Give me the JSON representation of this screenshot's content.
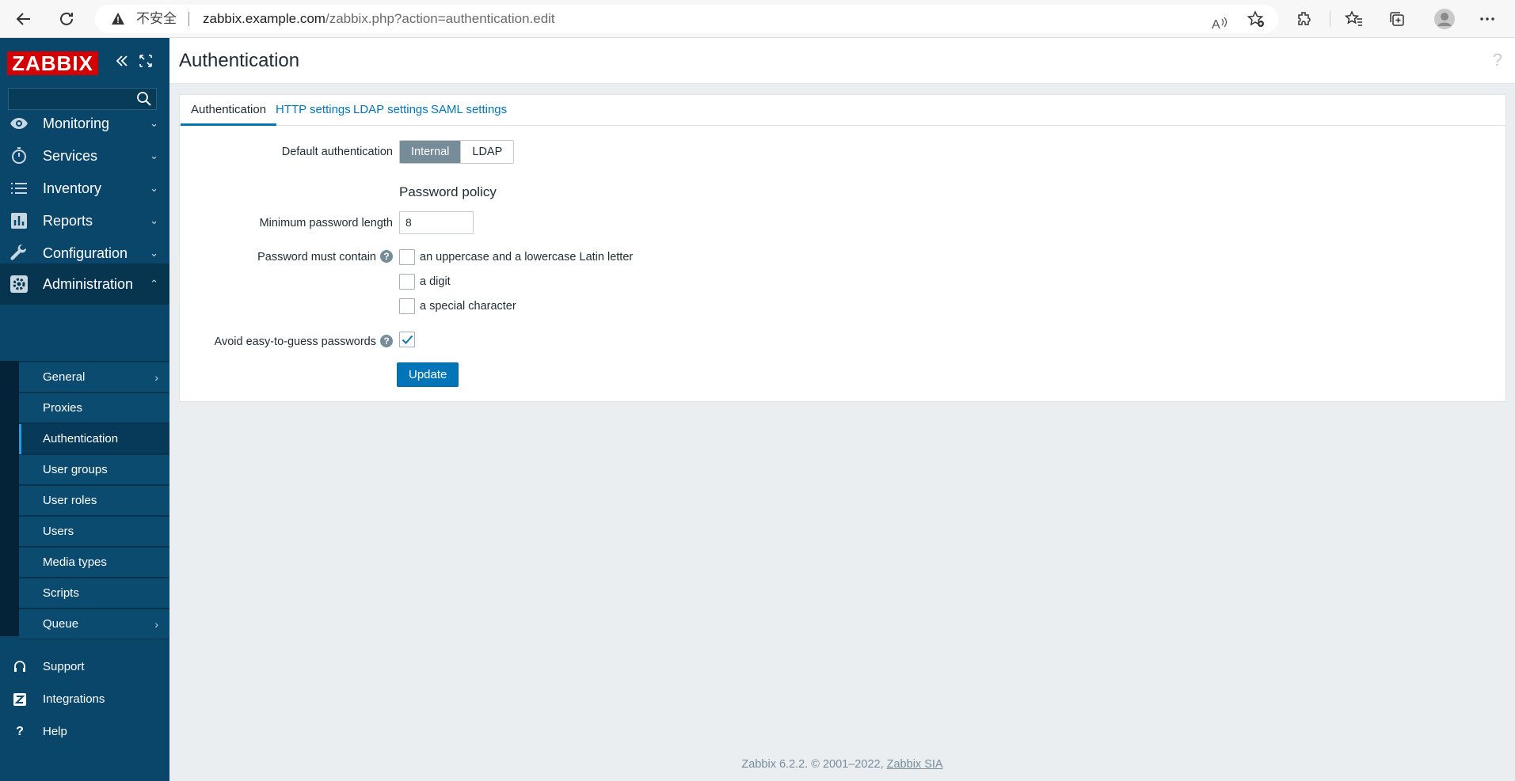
{
  "browser": {
    "insecure_label": "不安全",
    "url_host": "zabbix.example.com",
    "url_path": "/zabbix.php?action=authentication.edit"
  },
  "sidebar": {
    "logo": "ZABBIX",
    "search_placeholder": "",
    "menu": [
      {
        "label": "Monitoring",
        "icon": "eye-icon"
      },
      {
        "label": "Services",
        "icon": "stopwatch-icon"
      },
      {
        "label": "Inventory",
        "icon": "list-icon"
      },
      {
        "label": "Reports",
        "icon": "bar-chart-icon"
      },
      {
        "label": "Configuration",
        "icon": "wrench-icon"
      },
      {
        "label": "Administration",
        "icon": "gear-icon"
      }
    ],
    "submenu": [
      "General",
      "Proxies",
      "Authentication",
      "User groups",
      "User roles",
      "Users",
      "Media types",
      "Scripts",
      "Queue"
    ],
    "bottom": [
      {
        "label": "Support",
        "icon": "headset-icon"
      },
      {
        "label": "Integrations",
        "icon": "integrations-icon"
      },
      {
        "label": "Help",
        "icon": "help-icon"
      }
    ]
  },
  "page": {
    "title": "Authentication",
    "help": "?"
  },
  "tabs": [
    "Authentication",
    "HTTP settings",
    "LDAP settings",
    "SAML settings"
  ],
  "form": {
    "default_auth_label": "Default authentication",
    "default_auth_options": [
      "Internal",
      "LDAP"
    ],
    "default_auth_selected": "Internal",
    "policy_heading": "Password policy",
    "min_length_label": "Minimum password length",
    "min_length_value": "8",
    "must_contain_label": "Password must contain",
    "must_contain_options": [
      {
        "label": "an uppercase and a lowercase Latin letter",
        "checked": false
      },
      {
        "label": "a digit",
        "checked": false
      },
      {
        "label": "a special character",
        "checked": false
      }
    ],
    "avoid_label": "Avoid easy-to-guess passwords",
    "avoid_checked": true,
    "help_marker": "?",
    "update_button": "Update"
  },
  "footer": {
    "text": "Zabbix 6.2.2. © 2001–2022,",
    "link": "Zabbix SIA"
  },
  "colors": {
    "sidebar": "#0a466a",
    "accent": "#0275b8",
    "logo": "#d40000"
  }
}
